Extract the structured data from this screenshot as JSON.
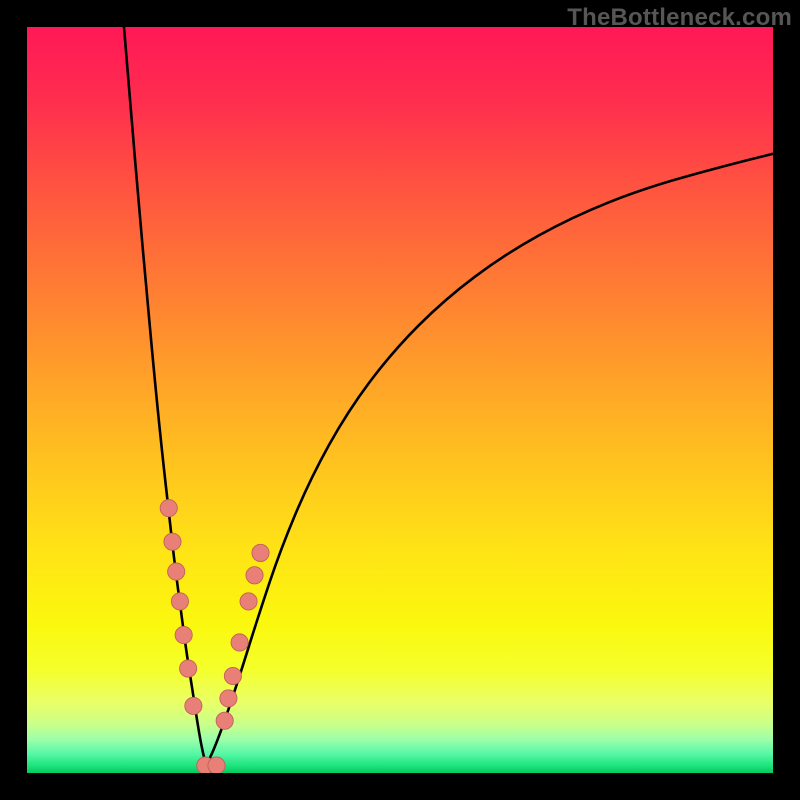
{
  "watermark": "TheBottleneck.com",
  "colors": {
    "frame": "#000000",
    "curve": "#000000",
    "dot_fill": "#e88077",
    "dot_stroke": "#c0605a",
    "gradient_stops": [
      {
        "offset": 0.0,
        "color": "#ff1857"
      },
      {
        "offset": 0.1,
        "color": "#ff2e4e"
      },
      {
        "offset": 0.22,
        "color": "#ff5540"
      },
      {
        "offset": 0.34,
        "color": "#ff7a34"
      },
      {
        "offset": 0.46,
        "color": "#ff9e2a"
      },
      {
        "offset": 0.58,
        "color": "#ffc21f"
      },
      {
        "offset": 0.7,
        "color": "#ffe316"
      },
      {
        "offset": 0.8,
        "color": "#fbf80e"
      },
      {
        "offset": 0.86,
        "color": "#f4ff2a"
      },
      {
        "offset": 0.905,
        "color": "#eaff66"
      },
      {
        "offset": 0.935,
        "color": "#c9ff8a"
      },
      {
        "offset": 0.955,
        "color": "#9cffaa"
      },
      {
        "offset": 0.975,
        "color": "#54f7a6"
      },
      {
        "offset": 0.99,
        "color": "#1de47c"
      },
      {
        "offset": 1.0,
        "color": "#06c95f"
      }
    ]
  },
  "chart_data": {
    "type": "line",
    "title": "",
    "xlabel": "",
    "ylabel": "",
    "xlim": [
      0,
      100
    ],
    "ylim": [
      0,
      100
    ],
    "grid": false,
    "notes": "Two black curves descending to a narrow V near x≈24; salmon dots cluster on both curve walls near the base; no axis ticks or labels are visible.",
    "series": [
      {
        "name": "left-curve",
        "x": [
          13.0,
          14.0,
          15.0,
          16.0,
          17.0,
          18.0,
          19.0,
          19.8,
          20.6,
          21.4,
          22.2,
          22.8,
          23.4,
          24.0
        ],
        "y": [
          100.0,
          88.0,
          76.0,
          65.0,
          54.0,
          44.0,
          35.0,
          28.0,
          22.0,
          16.0,
          11.0,
          7.0,
          3.5,
          1.0
        ]
      },
      {
        "name": "right-curve",
        "x": [
          24.0,
          25.0,
          26.5,
          28.5,
          31.0,
          34.0,
          38.0,
          43.0,
          49.0,
          56.0,
          64.0,
          73.0,
          83.0,
          94.0,
          100.0
        ],
        "y": [
          1.0,
          3.0,
          7.0,
          13.0,
          21.0,
          30.0,
          39.5,
          48.5,
          56.5,
          63.5,
          69.5,
          74.5,
          78.5,
          81.5,
          83.0
        ]
      },
      {
        "name": "valley-floor",
        "x": [
          23.4,
          24.6
        ],
        "y": [
          1.0,
          1.0
        ]
      }
    ],
    "scatter": [
      {
        "x": 19.0,
        "y": 35.5
      },
      {
        "x": 19.5,
        "y": 31.0
      },
      {
        "x": 20.0,
        "y": 27.0
      },
      {
        "x": 20.5,
        "y": 23.0
      },
      {
        "x": 21.0,
        "y": 18.5
      },
      {
        "x": 21.6,
        "y": 14.0
      },
      {
        "x": 22.3,
        "y": 9.0
      },
      {
        "x": 23.9,
        "y": 1.0
      },
      {
        "x": 25.4,
        "y": 1.0
      },
      {
        "x": 26.5,
        "y": 7.0
      },
      {
        "x": 27.0,
        "y": 10.0
      },
      {
        "x": 27.6,
        "y": 13.0
      },
      {
        "x": 28.5,
        "y": 17.5
      },
      {
        "x": 29.7,
        "y": 23.0
      },
      {
        "x": 30.5,
        "y": 26.5
      },
      {
        "x": 31.3,
        "y": 29.5
      }
    ]
  }
}
